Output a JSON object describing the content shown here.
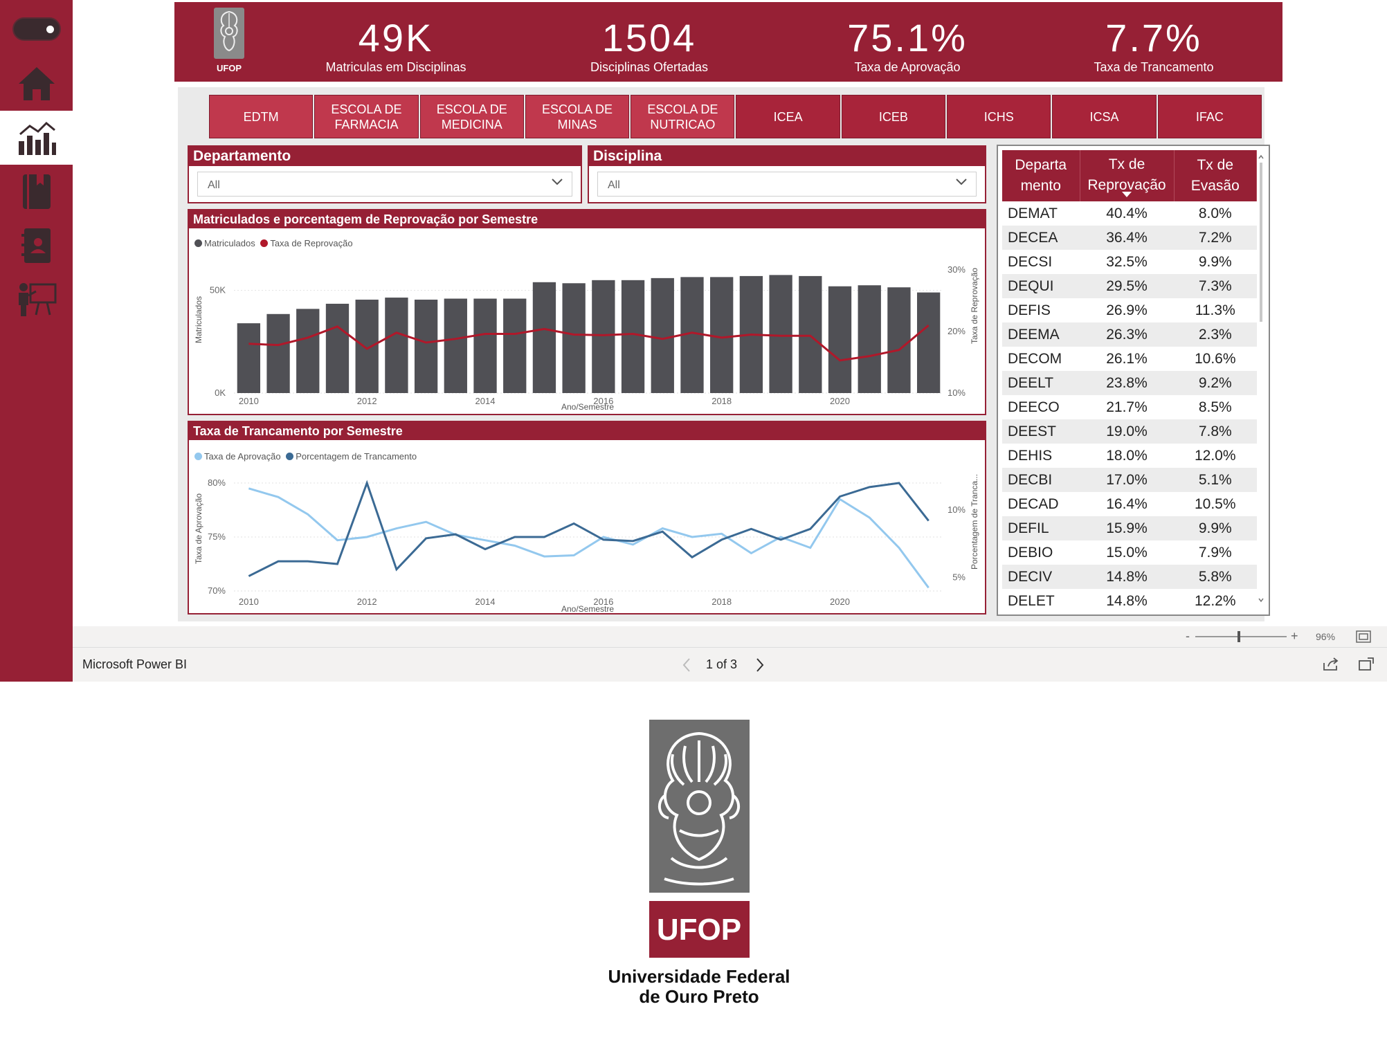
{
  "sidebar": {
    "items": [
      {
        "icon": "home-icon"
      },
      {
        "icon": "bar-line-chart-icon",
        "active": true
      },
      {
        "icon": "book-icon"
      },
      {
        "icon": "contact-book-icon"
      },
      {
        "icon": "teacher-presentation-icon"
      }
    ]
  },
  "header": {
    "logo_text": "UFOP",
    "kpis": [
      {
        "value": "49K",
        "label": "Matriculas em Disciplinas"
      },
      {
        "value": "1504",
        "label": "Disciplinas Ofertadas"
      },
      {
        "value": "75.1%",
        "label": "Taxa de Aprovação"
      },
      {
        "value": "7.7%",
        "label": "Taxa de Trancamento"
      }
    ]
  },
  "tabs": [
    "EDTM",
    "ESCOLA DE FARMACIA",
    "ESCOLA DE MEDICINA",
    "ESCOLA DE MINAS",
    "ESCOLA DE NUTRICAO",
    "ICEA",
    "ICEB",
    "ICHS",
    "ICSA",
    "IFAC"
  ],
  "slicers": {
    "departamento": {
      "title": "Departamento",
      "value": "All"
    },
    "disciplina": {
      "title": "Disciplina",
      "value": "All"
    }
  },
  "table": {
    "headers": [
      "Departa mento",
      "Tx de Reprovação",
      "Tx de Evasão"
    ],
    "rows": [
      [
        "DEMAT",
        "40.4%",
        "8.0%"
      ],
      [
        "DECEA",
        "36.4%",
        "7.2%"
      ],
      [
        "DECSI",
        "32.5%",
        "9.9%"
      ],
      [
        "DEQUI",
        "29.5%",
        "7.3%"
      ],
      [
        "DEFIS",
        "26.9%",
        "11.3%"
      ],
      [
        "DEEMA",
        "26.3%",
        "2.3%"
      ],
      [
        "DECOM",
        "26.1%",
        "10.6%"
      ],
      [
        "DEELT",
        "23.8%",
        "9.2%"
      ],
      [
        "DEECO",
        "21.7%",
        "8.5%"
      ],
      [
        "DEEST",
        "19.0%",
        "7.8%"
      ],
      [
        "DEHIS",
        "18.0%",
        "12.0%"
      ],
      [
        "DECBI",
        "17.0%",
        "5.1%"
      ],
      [
        "DECAD",
        "16.4%",
        "10.5%"
      ],
      [
        "DEFIL",
        "15.9%",
        "9.9%"
      ],
      [
        "DEBIO",
        "15.0%",
        "7.9%"
      ],
      [
        "DECIV",
        "14.8%",
        "5.8%"
      ],
      [
        "DELET",
        "14.8%",
        "12.2%"
      ]
    ]
  },
  "footer": {
    "app_name": "Microsoft Power BI",
    "page_indicator": "1 of 3",
    "zoom": "96%",
    "zoom_minus": "-",
    "zoom_plus": "+"
  },
  "bottom_logo": {
    "mark_text": "UFOP",
    "line1": "Universidade Federal",
    "line2": "de Ouro Preto"
  },
  "colors": {
    "brand": "#962035",
    "bar": "#505055",
    "reprov_line": "#b0182a",
    "aprov_line": "#93c8ee",
    "tranc_line": "#3b6a94"
  },
  "chart_data": [
    {
      "type": "bar",
      "title": "Matriculados e porcentagem de Reprovação por Semestre",
      "xlabel": "Ano/Semestre",
      "ylabel": "Matriculados",
      "y2label": "Taxa de Reprovação",
      "x_ticks": [
        "2010",
        "2012",
        "2014",
        "2016",
        "2018",
        "2020"
      ],
      "y_ticks": [
        "0K",
        "50K"
      ],
      "y2_ticks": [
        "10%",
        "20%",
        "30%"
      ],
      "ylim": [
        0,
        60000
      ],
      "y2lim": [
        10,
        30
      ],
      "x_start": 2010,
      "x_step": 0.5,
      "legend_position": "top-left",
      "series": [
        {
          "name": "Matriculados",
          "kind": "bar",
          "values": [
            34000,
            38500,
            41000,
            43500,
            45500,
            46500,
            45500,
            46000,
            46000,
            46000,
            54000,
            53500,
            55000,
            55000,
            56000,
            56500,
            56500,
            57000,
            57500,
            57000,
            52000,
            52500,
            51500,
            49000
          ]
        },
        {
          "name": "Taxa de Reprovação",
          "kind": "line",
          "values": [
            18,
            17.8,
            19,
            20.8,
            17.2,
            19.8,
            18.2,
            18.8,
            19.6,
            19.6,
            20.4,
            19.5,
            19.4,
            19.6,
            18.8,
            19.8,
            19,
            19.5,
            19.3,
            19.3,
            15.3,
            16,
            17,
            21
          ]
        }
      ]
    },
    {
      "type": "line",
      "title": "Taxa de Trancamento por Semestre",
      "xlabel": "Ano/Semestre",
      "ylabel": "Taxa de Aprovação",
      "y2label": "Porcentagem de Tranca...",
      "x_ticks": [
        "2010",
        "2012",
        "2014",
        "2016",
        "2018",
        "2020"
      ],
      "y_ticks": [
        "70%",
        "75%",
        "80%"
      ],
      "y2_ticks": [
        "5%",
        "10%"
      ],
      "ylim": [
        70,
        80
      ],
      "y2lim": [
        4,
        12
      ],
      "x_start": 2010,
      "x_step": 0.5,
      "legend_position": "top-left",
      "series": [
        {
          "name": "Taxa de Aprovação",
          "axis": "left",
          "values": [
            79.5,
            78.7,
            77.1,
            74.7,
            75.0,
            75.8,
            76.4,
            75.2,
            74.7,
            74.2,
            73.2,
            73.3,
            75.0,
            74.3,
            75.8,
            75.0,
            75.3,
            73.5,
            75.0,
            74.0,
            78.5,
            76.8,
            74.0,
            70.3
          ]
        },
        {
          "name": "Porcentagem de Trancamento",
          "axis": "right",
          "values": [
            5.1,
            6.2,
            6.2,
            6.0,
            12.0,
            5.6,
            7.9,
            8.2,
            7.1,
            8.0,
            8.0,
            9.0,
            7.8,
            7.7,
            8.4,
            6.5,
            7.8,
            8.6,
            7.8,
            8.6,
            11.0,
            11.7,
            12.0,
            9.2
          ]
        }
      ]
    }
  ]
}
